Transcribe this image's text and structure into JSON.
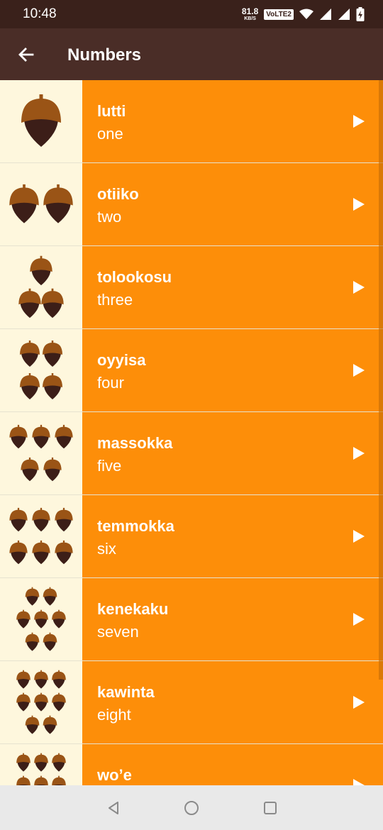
{
  "status_bar": {
    "time": "10:48",
    "net_speed": "81.8",
    "net_unit": "KB/S",
    "volte_label": "VoLTE2",
    "icons": [
      "wifi-icon",
      "signal-icon",
      "signal-icon",
      "battery-charging-icon"
    ]
  },
  "app_bar": {
    "title": "Numbers",
    "back_icon": "arrow-back-icon"
  },
  "words": [
    {
      "miwok": "lutti",
      "english": "one",
      "acorn_count": 1
    },
    {
      "miwok": "otiiko",
      "english": "two",
      "acorn_count": 2
    },
    {
      "miwok": "tolookosu",
      "english": "three",
      "acorn_count": 3
    },
    {
      "miwok": "oyyisa",
      "english": "four",
      "acorn_count": 4
    },
    {
      "miwok": "massokka",
      "english": "five",
      "acorn_count": 5
    },
    {
      "miwok": "temmokka",
      "english": "six",
      "acorn_count": 6
    },
    {
      "miwok": "kenekaku",
      "english": "seven",
      "acorn_count": 7
    },
    {
      "miwok": "kawinta",
      "english": "eight",
      "acorn_count": 8
    },
    {
      "miwok": "wo’e",
      "english": "",
      "acorn_count": 9
    }
  ],
  "colors": {
    "status_bar": "#3a211b",
    "app_bar": "#4a2d27",
    "row_background": "#fd8e09",
    "image_background": "#fef7dd",
    "acorn_cap": "#9a5416",
    "acorn_body": "#3c1e18",
    "nav_bar": "#e9e9e9"
  },
  "nav_bar": {
    "icons": [
      "back-triangle-icon",
      "home-circle-icon",
      "recents-square-icon"
    ]
  }
}
